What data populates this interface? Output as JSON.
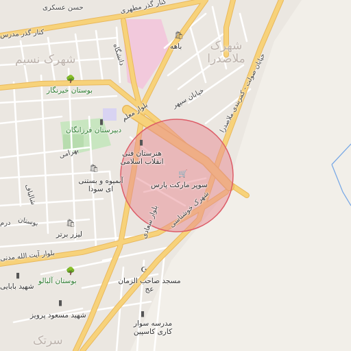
{
  "map": {
    "accent_circle_fill": "#e88a91",
    "accent_circle_stroke": "#dd5c67",
    "road_color": "#f7d27a",
    "road_edge_color": "#e9b85c",
    "park_color": "#c8e6c0",
    "campus_color": "#f2c9dc",
    "water_color": "#7aa9e6",
    "labels": {
      "hasan_askari": "حسن عسکری",
      "modares": "کنار گذر مطهری",
      "kenar_gozar": "کنار گذر مدرس",
      "shahrak_nasim": "شهرک نسیم",
      "shahrak_mollasadra": "شهرک ملاصدرا",
      "bustan_kheyrnegar": "بوستان خیرنگار",
      "danshgah": "دانشگاه",
      "bahe": "باهه",
      "khiaban_sepehr": "خیابان سپهر",
      "khiaban_sowlat": "خیابان صولت - کمربندی ملاصدرا",
      "bolvar_moalem": "بلوار معلم",
      "dabirestan_farzanegan": "دبیرستان فرزانگان",
      "bahrami": "بهرامی",
      "honarestan": "هنرستان فنی انقلاب اسلامی",
      "supermarket_pars": "سوپر مارکت پارس",
      "shahrak_khoshnasim": "شهرک خوشناسی",
      "ab_mive": "آبمیوه و بستنی ای سودا",
      "bolvar_saadi": "بلوار سعادی",
      "kamarbandi": "کمربندی ملاصدرا",
      "shalbaf": "شالباف",
      "bustan_short": "بوستان",
      "dar": "درم",
      "liz_bartar": "لیزر برتر",
      "bolvar_ayatollah": "بلوار آیت الله مدنی",
      "shahid_babaei": "شهید بابایی",
      "bustan_albalu": "بوستان آلبالو",
      "masjed": "مسجد صاحب الزمان عج",
      "shahid_masoud_parviz": "شهید مسعود پرویز",
      "madrese_savar": "مدرسه سوار کاری کاسپین",
      "sartak": "سرتک",
      "jade": "جاده"
    },
    "icons": {
      "shop": "shopping-bag-icon",
      "school": "school-icon",
      "mosque": "mosque-icon",
      "tree": "tree-icon"
    }
  }
}
